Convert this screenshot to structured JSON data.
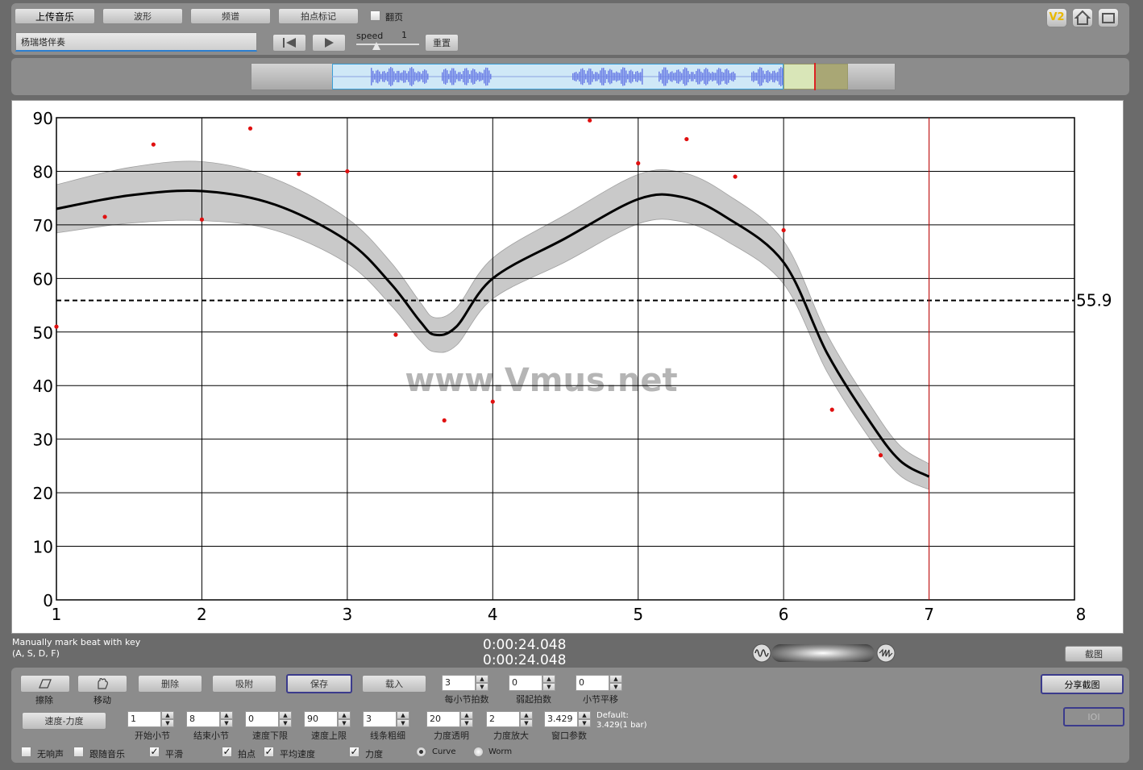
{
  "toolbar": {
    "upload": "上传音乐",
    "waveform": "波形",
    "spectrum": "频谱",
    "beat_mark": "拍点标记",
    "page_turn": "翻页",
    "song_title": "杨瑞塔伴奏",
    "speed_label": "speed",
    "speed_value": "1",
    "reset": "重置",
    "v2_badge": "V2"
  },
  "status": {
    "hint_line1": "Manually mark beat with key",
    "hint_line2": "(A, S, D, F)",
    "time1": "0:00:24.048",
    "time2": "0:00:24.048",
    "screenshot": "截图"
  },
  "controls": {
    "erase": "擦除",
    "move": "移动",
    "delete": "删除",
    "snap": "吸附",
    "save": "保存",
    "load": "载入",
    "tempo_dynamics": "速度-力度",
    "share": "分享截图",
    "ioi": "IOI",
    "default_label": "Default:",
    "default_value": "3.429(1 bar)",
    "spinners": [
      {
        "label": "每小节拍数",
        "value": "3"
      },
      {
        "label": "弱起拍数",
        "value": "0"
      },
      {
        "label": "小节平移",
        "value": "0"
      },
      {
        "label": "开始小节",
        "value": "1"
      },
      {
        "label": "结束小节",
        "value": "8"
      },
      {
        "label": "速度下限",
        "value": "0"
      },
      {
        "label": "速度上限",
        "value": "90"
      },
      {
        "label": "线条粗细",
        "value": "3"
      },
      {
        "label": "力度透明",
        "value": "20"
      },
      {
        "label": "力度放大",
        "value": "2"
      },
      {
        "label": "窗口参数",
        "value": "3.429"
      }
    ],
    "checks": [
      {
        "label": "无响声",
        "checked": false
      },
      {
        "label": "跟随音乐",
        "checked": false
      },
      {
        "label": "平滑",
        "checked": true
      },
      {
        "label": "拍点",
        "checked": true
      },
      {
        "label": "平均速度",
        "checked": true
      },
      {
        "label": "力度",
        "checked": true
      }
    ],
    "radio_curve": "Curve",
    "radio_worm": "Worm"
  },
  "chart_data": {
    "type": "line",
    "watermark": "www.Vmus.net",
    "xlim": [
      1,
      8
    ],
    "ylim": [
      0,
      90
    ],
    "xticks": [
      1,
      2,
      3,
      4,
      5,
      6,
      7,
      8
    ],
    "yticks": [
      0,
      10,
      20,
      30,
      40,
      50,
      60,
      70,
      80,
      90
    ],
    "grid": true,
    "average": 55.9,
    "average_label": "55.9",
    "cursor_x": 7,
    "curve": {
      "x": [
        1,
        1.5,
        2,
        2.5,
        3,
        3.3,
        3.5,
        3.6,
        3.75,
        4,
        4.5,
        5,
        5.3,
        5.6,
        6,
        6.3,
        6.6,
        6.8,
        7
      ],
      "y": [
        73,
        75.5,
        76.3,
        73.8,
        67,
        59,
        52,
        49.5,
        51,
        60,
        67.5,
        74.8,
        75.2,
        71.5,
        63,
        46,
        33,
        26,
        23
      ]
    },
    "band_halfwidth": [
      4.5,
      5.2,
      5.5,
      4.8,
      4.2,
      4,
      3.6,
      3.2,
      3.5,
      3.8,
      4.4,
      4.6,
      4.6,
      4.4,
      4,
      3.5,
      3.2,
      2.8,
      2.4
    ],
    "beats": {
      "x": [
        1,
        1.333,
        1.667,
        2,
        2.333,
        2.667,
        3,
        3.333,
        3.667,
        4,
        4.667,
        5,
        5.333,
        5.667,
        6,
        6.333,
        6.667
      ],
      "y": [
        51,
        71.5,
        85,
        71,
        88,
        79.5,
        80,
        49.5,
        33.5,
        37,
        89.5,
        81.5,
        86,
        79,
        69,
        35.5,
        27
      ]
    }
  }
}
